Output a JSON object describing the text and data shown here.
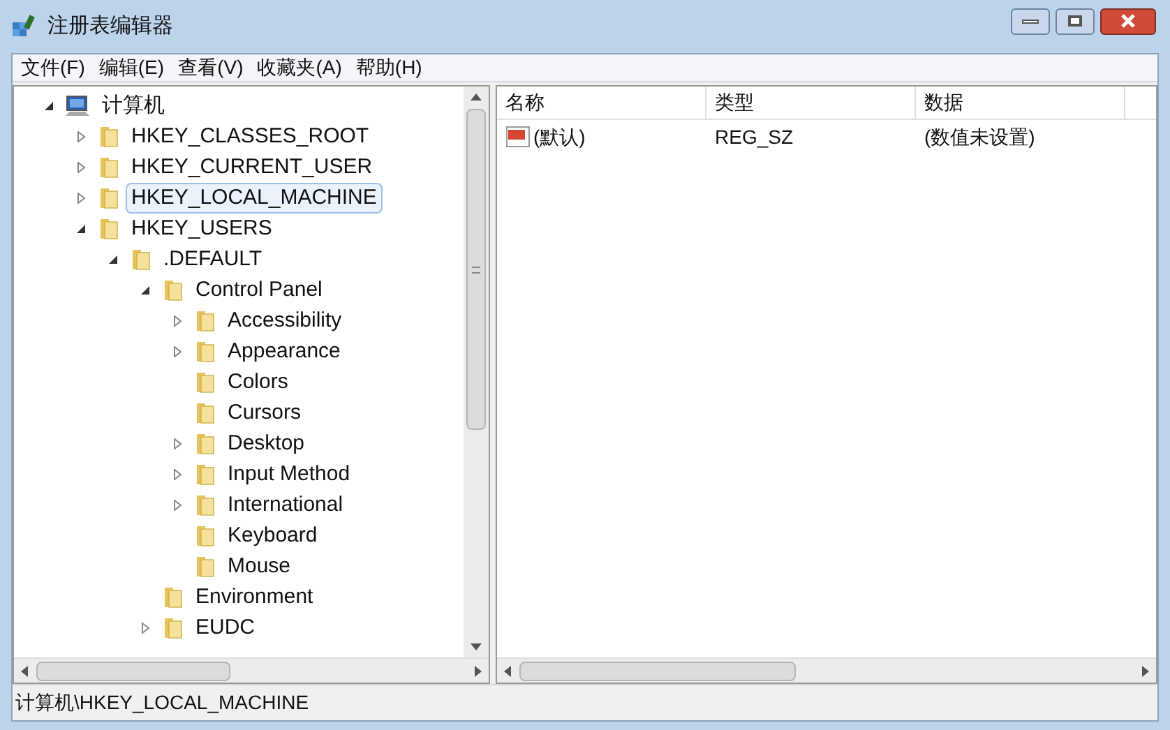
{
  "window": {
    "title": "注册表编辑器"
  },
  "menu": [
    "文件(F)",
    "编辑(E)",
    "查看(V)",
    "收藏夹(A)",
    "帮助(H)"
  ],
  "tree": [
    {
      "label": "计算机",
      "kind": "computer",
      "expanded": true,
      "selected": false,
      "children": [
        {
          "label": "HKEY_CLASSES_ROOT",
          "kind": "folder",
          "expanded": false,
          "selected": false
        },
        {
          "label": "HKEY_CURRENT_USER",
          "kind": "folder",
          "expanded": false,
          "selected": false
        },
        {
          "label": "HKEY_LOCAL_MACHINE",
          "kind": "folder",
          "expanded": false,
          "selected": true
        },
        {
          "label": "HKEY_USERS",
          "kind": "folder",
          "expanded": true,
          "selected": false,
          "children": [
            {
              "label": ".DEFAULT",
              "kind": "folder",
              "expanded": true,
              "selected": false,
              "children": [
                {
                  "label": "Control Panel",
                  "kind": "folder",
                  "expanded": true,
                  "selected": false,
                  "children": [
                    {
                      "label": "Accessibility",
                      "kind": "folder",
                      "expanded": false,
                      "selected": false
                    },
                    {
                      "label": "Appearance",
                      "kind": "folder",
                      "expanded": false,
                      "selected": false
                    },
                    {
                      "label": "Colors",
                      "kind": "folder",
                      "selected": false
                    },
                    {
                      "label": "Cursors",
                      "kind": "folder",
                      "selected": false
                    },
                    {
                      "label": "Desktop",
                      "kind": "folder",
                      "expanded": false,
                      "selected": false
                    },
                    {
                      "label": "Input Method",
                      "kind": "folder",
                      "expanded": false,
                      "selected": false
                    },
                    {
                      "label": "International",
                      "kind": "folder",
                      "expanded": false,
                      "selected": false
                    },
                    {
                      "label": "Keyboard",
                      "kind": "folder",
                      "selected": false
                    },
                    {
                      "label": "Mouse",
                      "kind": "folder",
                      "selected": false
                    }
                  ]
                },
                {
                  "label": "Environment",
                  "kind": "folder",
                  "selected": false
                },
                {
                  "label": "EUDC",
                  "kind": "folder",
                  "expanded": false,
                  "selected": false
                }
              ]
            }
          ]
        }
      ]
    }
  ],
  "table": {
    "columns": [
      "名称",
      "类型",
      "数据"
    ],
    "rows": [
      {
        "cells": [
          "(默认)",
          "REG_SZ",
          "(数值未设置)"
        ]
      }
    ]
  },
  "status_bar": "计算机\\HKEY_LOCAL_MACHINE"
}
